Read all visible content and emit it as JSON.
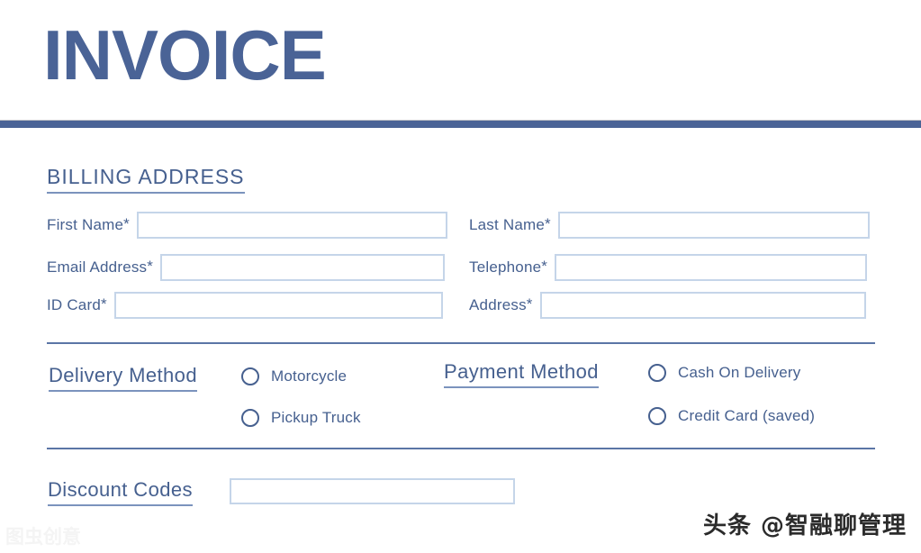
{
  "document": {
    "title": "INVOICE"
  },
  "billing": {
    "heading": "BILLING ADDRESS",
    "required_marker": "*",
    "fields": [
      {
        "label": "First Name",
        "required": "*",
        "value": "",
        "placeholder": ""
      },
      {
        "label": "Last Name",
        "required": "*",
        "value": "",
        "placeholder": ""
      },
      {
        "label": "Email Address",
        "required": "*",
        "value": "",
        "placeholder": ""
      },
      {
        "label": "Telephone",
        "required": "*",
        "value": "",
        "placeholder": ""
      },
      {
        "label": "ID Card",
        "required": "*",
        "value": "",
        "placeholder": ""
      },
      {
        "label": "Address",
        "required": "*",
        "value": "",
        "placeholder": ""
      }
    ]
  },
  "delivery_method": {
    "heading": "Delivery Method",
    "options": [
      {
        "label": "Motorcycle",
        "selected": false
      },
      {
        "label": "Pickup Truck",
        "selected": false
      }
    ]
  },
  "payment_method": {
    "heading": "Payment Method",
    "options": [
      {
        "label": "Cash On Delivery",
        "selected": false
      },
      {
        "label": "Credit Card (saved)",
        "selected": false
      }
    ]
  },
  "discount": {
    "heading": "Discount Codes",
    "value": "",
    "placeholder": ""
  },
  "watermarks": {
    "brand": "头条 @智融聊管理",
    "corner": "图虫创意"
  },
  "colors": {
    "accent": "#4a6396",
    "text": "#46608f",
    "input_border": "#c5d5e9",
    "divider": "#5b75a6"
  }
}
